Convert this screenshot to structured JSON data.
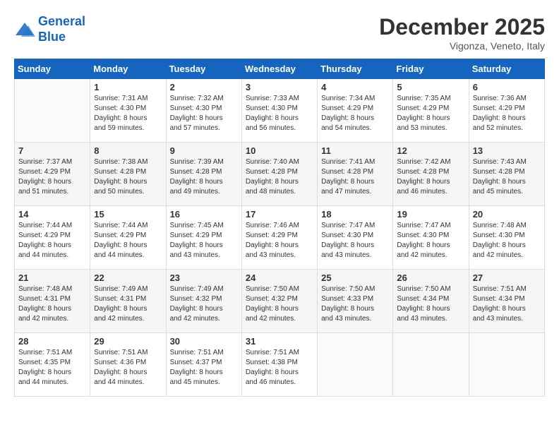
{
  "header": {
    "logo_line1": "General",
    "logo_line2": "Blue",
    "month": "December 2025",
    "location": "Vigonza, Veneto, Italy"
  },
  "weekdays": [
    "Sunday",
    "Monday",
    "Tuesday",
    "Wednesday",
    "Thursday",
    "Friday",
    "Saturday"
  ],
  "weeks": [
    [
      {
        "day": "",
        "info": ""
      },
      {
        "day": "1",
        "info": "Sunrise: 7:31 AM\nSunset: 4:30 PM\nDaylight: 8 hours\nand 59 minutes."
      },
      {
        "day": "2",
        "info": "Sunrise: 7:32 AM\nSunset: 4:30 PM\nDaylight: 8 hours\nand 57 minutes."
      },
      {
        "day": "3",
        "info": "Sunrise: 7:33 AM\nSunset: 4:30 PM\nDaylight: 8 hours\nand 56 minutes."
      },
      {
        "day": "4",
        "info": "Sunrise: 7:34 AM\nSunset: 4:29 PM\nDaylight: 8 hours\nand 54 minutes."
      },
      {
        "day": "5",
        "info": "Sunrise: 7:35 AM\nSunset: 4:29 PM\nDaylight: 8 hours\nand 53 minutes."
      },
      {
        "day": "6",
        "info": "Sunrise: 7:36 AM\nSunset: 4:29 PM\nDaylight: 8 hours\nand 52 minutes."
      }
    ],
    [
      {
        "day": "7",
        "info": "Sunrise: 7:37 AM\nSunset: 4:29 PM\nDaylight: 8 hours\nand 51 minutes."
      },
      {
        "day": "8",
        "info": "Sunrise: 7:38 AM\nSunset: 4:28 PM\nDaylight: 8 hours\nand 50 minutes."
      },
      {
        "day": "9",
        "info": "Sunrise: 7:39 AM\nSunset: 4:28 PM\nDaylight: 8 hours\nand 49 minutes."
      },
      {
        "day": "10",
        "info": "Sunrise: 7:40 AM\nSunset: 4:28 PM\nDaylight: 8 hours\nand 48 minutes."
      },
      {
        "day": "11",
        "info": "Sunrise: 7:41 AM\nSunset: 4:28 PM\nDaylight: 8 hours\nand 47 minutes."
      },
      {
        "day": "12",
        "info": "Sunrise: 7:42 AM\nSunset: 4:28 PM\nDaylight: 8 hours\nand 46 minutes."
      },
      {
        "day": "13",
        "info": "Sunrise: 7:43 AM\nSunset: 4:28 PM\nDaylight: 8 hours\nand 45 minutes."
      }
    ],
    [
      {
        "day": "14",
        "info": "Sunrise: 7:44 AM\nSunset: 4:29 PM\nDaylight: 8 hours\nand 44 minutes."
      },
      {
        "day": "15",
        "info": "Sunrise: 7:44 AM\nSunset: 4:29 PM\nDaylight: 8 hours\nand 44 minutes."
      },
      {
        "day": "16",
        "info": "Sunrise: 7:45 AM\nSunset: 4:29 PM\nDaylight: 8 hours\nand 43 minutes."
      },
      {
        "day": "17",
        "info": "Sunrise: 7:46 AM\nSunset: 4:29 PM\nDaylight: 8 hours\nand 43 minutes."
      },
      {
        "day": "18",
        "info": "Sunrise: 7:47 AM\nSunset: 4:30 PM\nDaylight: 8 hours\nand 43 minutes."
      },
      {
        "day": "19",
        "info": "Sunrise: 7:47 AM\nSunset: 4:30 PM\nDaylight: 8 hours\nand 42 minutes."
      },
      {
        "day": "20",
        "info": "Sunrise: 7:48 AM\nSunset: 4:30 PM\nDaylight: 8 hours\nand 42 minutes."
      }
    ],
    [
      {
        "day": "21",
        "info": "Sunrise: 7:48 AM\nSunset: 4:31 PM\nDaylight: 8 hours\nand 42 minutes."
      },
      {
        "day": "22",
        "info": "Sunrise: 7:49 AM\nSunset: 4:31 PM\nDaylight: 8 hours\nand 42 minutes."
      },
      {
        "day": "23",
        "info": "Sunrise: 7:49 AM\nSunset: 4:32 PM\nDaylight: 8 hours\nand 42 minutes."
      },
      {
        "day": "24",
        "info": "Sunrise: 7:50 AM\nSunset: 4:32 PM\nDaylight: 8 hours\nand 42 minutes."
      },
      {
        "day": "25",
        "info": "Sunrise: 7:50 AM\nSunset: 4:33 PM\nDaylight: 8 hours\nand 43 minutes."
      },
      {
        "day": "26",
        "info": "Sunrise: 7:50 AM\nSunset: 4:34 PM\nDaylight: 8 hours\nand 43 minutes."
      },
      {
        "day": "27",
        "info": "Sunrise: 7:51 AM\nSunset: 4:34 PM\nDaylight: 8 hours\nand 43 minutes."
      }
    ],
    [
      {
        "day": "28",
        "info": "Sunrise: 7:51 AM\nSunset: 4:35 PM\nDaylight: 8 hours\nand 44 minutes."
      },
      {
        "day": "29",
        "info": "Sunrise: 7:51 AM\nSunset: 4:36 PM\nDaylight: 8 hours\nand 44 minutes."
      },
      {
        "day": "30",
        "info": "Sunrise: 7:51 AM\nSunset: 4:37 PM\nDaylight: 8 hours\nand 45 minutes."
      },
      {
        "day": "31",
        "info": "Sunrise: 7:51 AM\nSunset: 4:38 PM\nDaylight: 8 hours\nand 46 minutes."
      },
      {
        "day": "",
        "info": ""
      },
      {
        "day": "",
        "info": ""
      },
      {
        "day": "",
        "info": ""
      }
    ]
  ]
}
